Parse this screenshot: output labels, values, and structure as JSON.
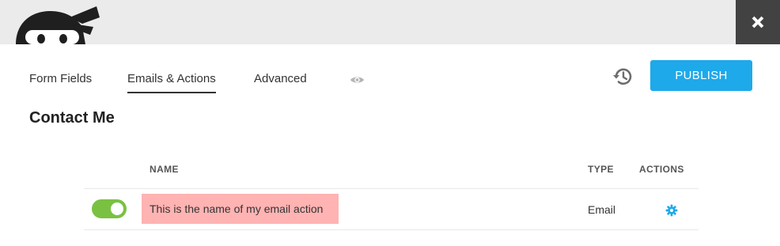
{
  "header": {
    "logo_icon": "ninja-logo-icon",
    "close_icon": "close-icon"
  },
  "tabs": [
    {
      "label": "Form Fields",
      "active": false
    },
    {
      "label": "Emails & Actions",
      "active": true
    },
    {
      "label": "Advanced",
      "active": false
    }
  ],
  "preview_icon": "eye-icon",
  "history_icon": "history-icon",
  "publish_label": "PUBLISH",
  "form_title": "Contact Me",
  "table": {
    "columns": [
      "NAME",
      "TYPE",
      "ACTIONS"
    ],
    "rows": [
      {
        "enabled": true,
        "name": "This is the name of my email action",
        "type": "Email",
        "action_icon": "gear-icon"
      }
    ]
  },
  "colors": {
    "accent": "#1ea9ea",
    "toggle_on": "#7ac142",
    "highlight": "#ffb3b3",
    "header_band": "#ebebec",
    "close_bg": "#424242"
  }
}
